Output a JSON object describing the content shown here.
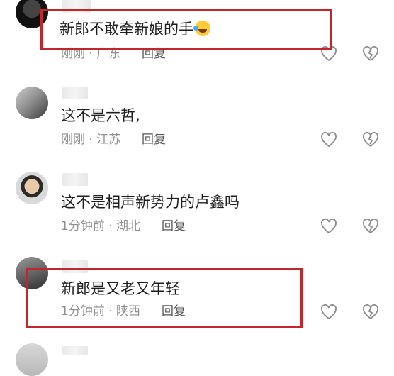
{
  "comments": [
    {
      "text": "新郎不敢牵新娘的手",
      "emoji": "rofl-emoji",
      "time": "刚刚",
      "location": "广东",
      "reply": "回复"
    },
    {
      "text": "这不是六哲,",
      "time": "刚刚",
      "location": "江苏",
      "reply": "回复"
    },
    {
      "text": "这不是相声新势力的卢鑫吗",
      "time": "1分钟前",
      "location": "湖北",
      "reply": "回复"
    },
    {
      "text": "新郎是又老又年轻",
      "time": "1分钟前",
      "location": "陕西",
      "reply": "回复"
    }
  ],
  "separator": " · ",
  "colors": {
    "highlight": "#c0262a",
    "meta": "#8f8f8f"
  }
}
